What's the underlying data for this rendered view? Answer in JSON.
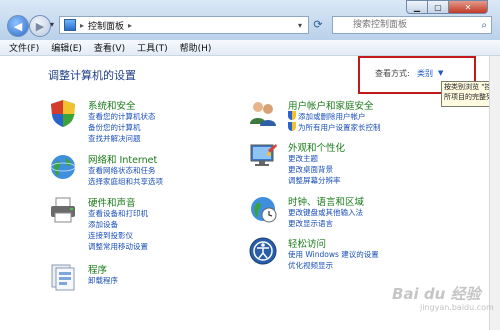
{
  "addressbar": {
    "sep": "▸",
    "crumb": "控制面板",
    "arrow": "▸"
  },
  "search": {
    "placeholder": "搜索控制面板"
  },
  "menu": [
    "文件(F)",
    "编辑(E)",
    "查看(V)",
    "工具(T)",
    "帮助(H)"
  ],
  "main": {
    "title": "调整计算机的设置",
    "view_by_label": "查看方式:",
    "view_by_value": "类别"
  },
  "tooltip": {
    "line1": "按类别浏览 \"控",
    "line2": "所项目的完整列表"
  },
  "categories": [
    {
      "title": "系统和安全",
      "links": [
        "查看您的计算机状态",
        "备份您的计算机",
        "查找并解决问题"
      ]
    },
    {
      "title": "网络和 Internet",
      "links": [
        "查看网络状态和任务",
        "选择家庭组和共享选项"
      ]
    },
    {
      "title": "硬件和声音",
      "links": [
        "查看设备和打印机",
        "添加设备",
        "连接到投影仪",
        "调整常用移动设置"
      ]
    },
    {
      "title": "程序",
      "links": [
        "卸载程序"
      ]
    },
    {
      "title": "用户帐户和家庭安全",
      "links": [
        "添加或删除用户帐户",
        "为所有用户设置家长控制"
      ]
    },
    {
      "title": "外观和个性化",
      "links": [
        "更改主题",
        "更改桌面背景",
        "调整屏幕分辨率"
      ]
    },
    {
      "title": "时钟、语言和区域",
      "links": [
        "更改键盘或其他输入法",
        "更改显示语言"
      ]
    },
    {
      "title": "轻松访问",
      "links": [
        "使用 Windows 建议的设置",
        "优化视频显示"
      ]
    }
  ],
  "watermark": {
    "logo": "Bai du 经验",
    "url": "jingyan.baidu.com"
  },
  "icons": [
    "shield-security-icon",
    "network-globe-icon",
    "printer-icon",
    "programs-icon",
    "users-icon",
    "monitor-appearance-icon",
    "clock-globe-icon",
    "accessibility-icon"
  ]
}
